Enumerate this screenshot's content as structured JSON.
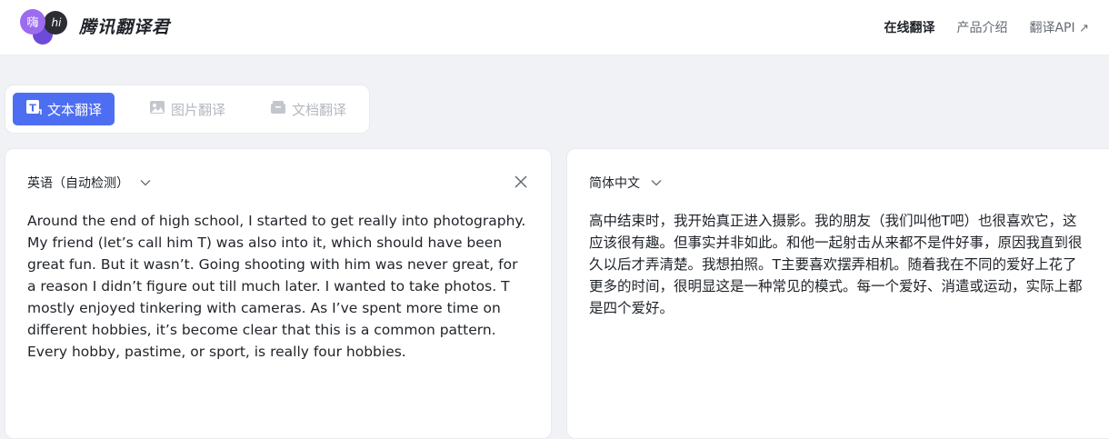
{
  "header": {
    "logo": {
      "left_glyph": "嗨",
      "right_glyph": "hi"
    },
    "brand": "腾讯翻译君",
    "nav": [
      {
        "label": "在线翻译",
        "active": true
      },
      {
        "label": "产品介绍",
        "active": false
      },
      {
        "label": "翻译API",
        "active": false,
        "icon": "external-arrow-icon"
      }
    ]
  },
  "tabs": [
    {
      "label": "文本翻译",
      "icon": "text-translate-icon",
      "active": true
    },
    {
      "label": "图片翻译",
      "icon": "image-icon",
      "active": false
    },
    {
      "label": "文档翻译",
      "icon": "document-icon",
      "active": false
    }
  ],
  "source": {
    "language": "英语（自动检测）",
    "text": "Around the end of high school, I started to get really into photography. My friend (let’s call him T) was also into it, which should have been great fun. But it wasn’t. Going shooting with him was never great, for a reason I didn’t figure out till much later. I wanted to take photos. T mostly enjoyed tinkering with cameras. As I’ve spent more time on different hobbies, it’s become clear that this is a common pattern. Every hobby, pastime, or sport, is really four hobbies."
  },
  "target": {
    "language": "简体中文",
    "text": "高中结束时，我开始真正进入摄影。我的朋友（我们叫他T吧）也很喜欢它，这应该很有趣。但事实并非如此。和他一起射击从来都不是件好事，原因我直到很久以后才弄清楚。我想拍照。T主要喜欢摆弄相机。随着我在不同的爱好上花了更多的时间，很明显这是一种常见的模式。每一个爱好、消遣或运动，实际上都是四个爱好。"
  },
  "colors": {
    "accent": "#4e6ef2",
    "logo_purple": "#8b5cf6",
    "logo_dark": "#2b2d33",
    "background": "#f0f2f6"
  }
}
